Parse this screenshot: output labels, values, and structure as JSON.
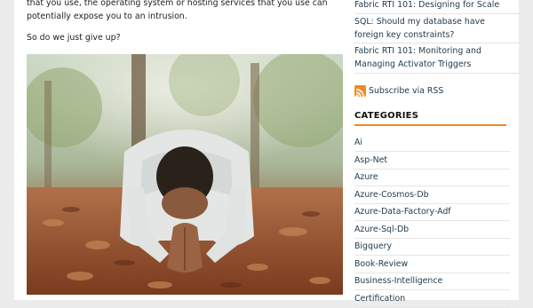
{
  "article": {
    "paragraph1": "that you use, the operating system or hosting services that you use can potentially expose you to an intrusion.",
    "paragraph2": "So do we just give up?",
    "hero_image": "person kneeling and praying on autumn leaves in a park"
  },
  "sidebar": {
    "recent_posts": [
      "Fabric RTI 101: Designing for Scale",
      "SQL: Should my database have foreign key constraints?",
      "Fabric RTI 101: Monitoring and Managing Activator Triggers"
    ],
    "rss_label": "Subscribe via RSS",
    "rss_icon": "rss-icon",
    "categories_heading": "CATEGORIES",
    "categories": [
      "Ai",
      "Asp-Net",
      "Azure",
      "Azure-Cosmos-Db",
      "Azure-Data-Factory-Adf",
      "Azure-Sql-Db",
      "Bigquery",
      "Book-Review",
      "Business-Intelligence",
      "Certification"
    ]
  },
  "colors": {
    "accent": "#f08a24",
    "link": "#1f3a4d",
    "page_background": "#ececec"
  }
}
